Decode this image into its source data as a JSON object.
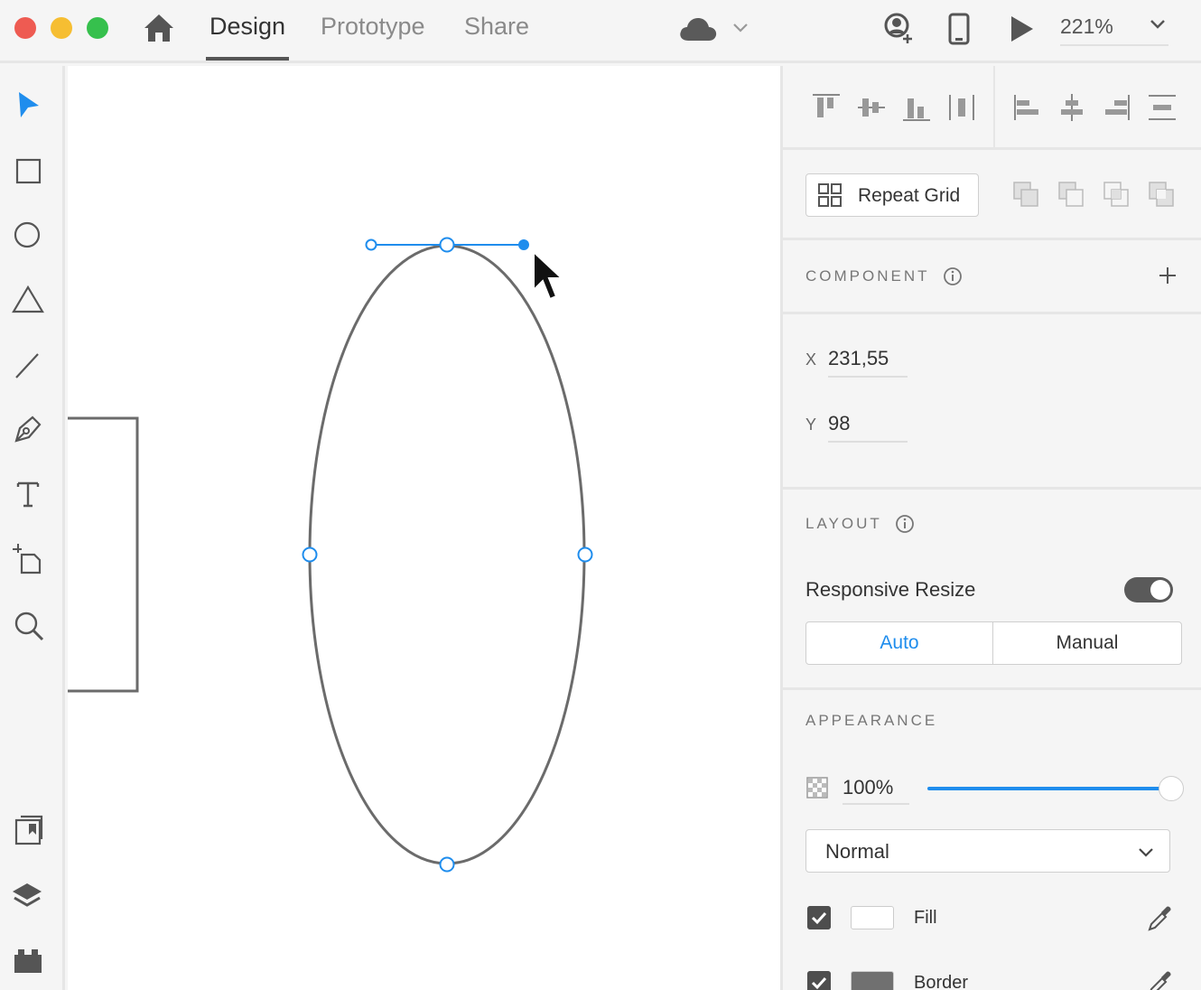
{
  "toolbar": {
    "tabs": [
      "Design",
      "Prototype",
      "Share"
    ],
    "active_tab": "Design",
    "zoom": "221%"
  },
  "left_tools": [
    "select-icon",
    "rectangle-icon",
    "ellipse-icon",
    "polygon-icon",
    "line-icon",
    "pen-icon",
    "text-icon",
    "artboard-icon",
    "zoom-icon",
    "assets-icon",
    "layers-icon",
    "plugins-icon"
  ],
  "panel": {
    "repeat_grid_label": "Repeat Grid",
    "component_title": "COMPONENT",
    "x_label": "X",
    "x_value": "231,55",
    "y_label": "Y",
    "y_value": "98",
    "layout_title": "LAYOUT",
    "responsive_resize_label": "Responsive Resize",
    "responsive_resize_on": true,
    "auto_label": "Auto",
    "manual_label": "Manual",
    "appearance_title": "APPEARANCE",
    "opacity": "100%",
    "opacity_fraction": 1.0,
    "blend_mode": "Normal",
    "fill_label": "Fill",
    "fill_color": "#ffffff",
    "border_label": "Border",
    "border_color": "#707070"
  },
  "colors": {
    "accent": "#1f8ded",
    "shape_stroke": "#6b6b6b"
  }
}
